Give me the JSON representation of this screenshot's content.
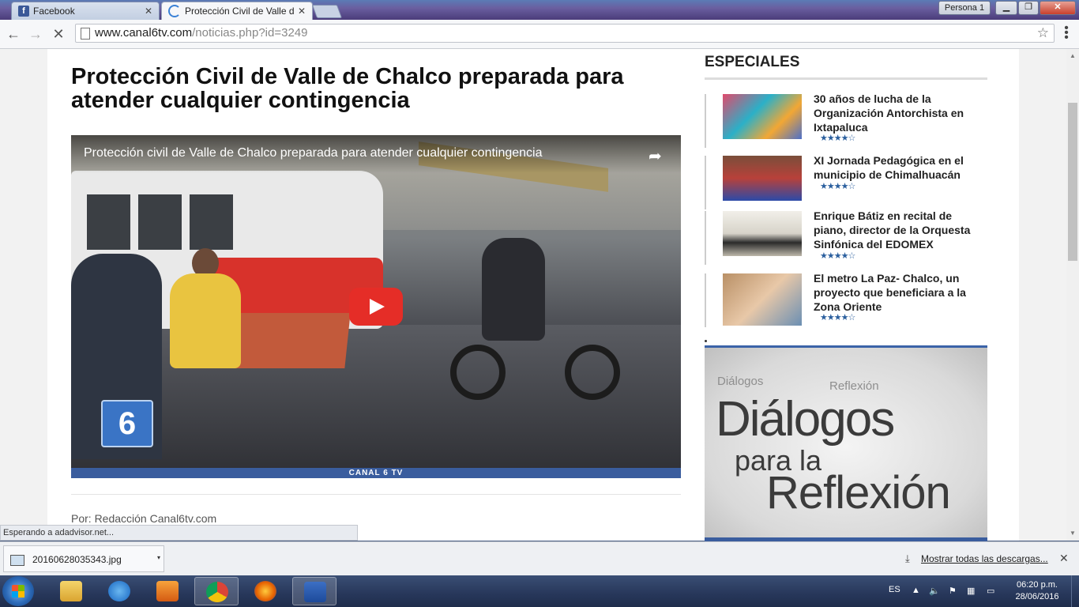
{
  "browser": {
    "tabs": [
      {
        "label": "Facebook",
        "icon": "facebook-icon"
      },
      {
        "label": "Protección Civil de Valle d",
        "icon": "loading-spinner-icon"
      }
    ],
    "profile_label": "Persona 1",
    "url_host": "www.canal6tv.com",
    "url_path": "/noticias.php?id=3249"
  },
  "article": {
    "title": "Protección Civil de Valle de Chalco preparada para atender cualquier contingencia",
    "video_title": "Protección civil de Valle de Chalco preparada para atender cualquier contingencia",
    "video_logo": "6",
    "video_footer": "CANAL 6 TV",
    "byline": "Por: Redacción Canal6tv.com"
  },
  "sidebar": {
    "heading": "ESPECIALES",
    "items": [
      {
        "title": "30 años de lucha de la Organización Antorchista en Ixtapaluca",
        "stars": "★★★★☆",
        "rating": 4
      },
      {
        "title": "XI Jornada Pedagógica en el municipio de Chimalhuacán",
        "stars": "★★★★☆",
        "rating": 4
      },
      {
        "title": "Enrique Bátiz en recital de piano, director de la Orquesta Sinfónica del EDOMEX",
        "stars": "★★★★☆",
        "rating": 4
      },
      {
        "title": "El metro La Paz- Chalco, un proyecto que beneficiara a la Zona Oriente",
        "stars": "★★★★☆",
        "rating": 4
      }
    ],
    "banner": {
      "line1": "Diálogos",
      "line2": "para la",
      "line3": "Reflexión",
      "ghost1": "Diálogos",
      "ghost2": "Reflexión"
    }
  },
  "status_text": "Esperando a adadvisor.net...",
  "downloads": {
    "file_name": "20160628035343.jpg",
    "show_all": "Mostrar todas las descargas..."
  },
  "taskbar": {
    "language": "ES",
    "time": "06:20 p.m.",
    "date": "28/06/2016"
  },
  "colors": {
    "accent_blue": "#3b63a8",
    "play_red": "#e52d27",
    "star_blue": "#2b5f9e"
  }
}
